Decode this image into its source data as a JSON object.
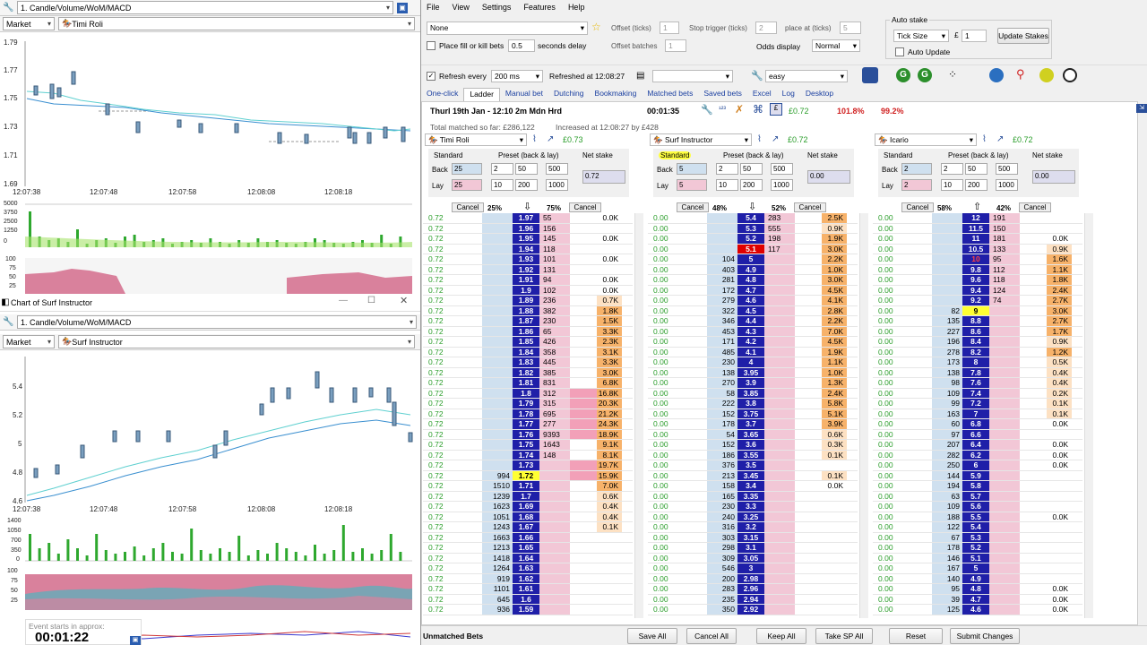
{
  "chart1": {
    "title": "1. Candle/Volume/WoM/MACD",
    "market_label": "Market",
    "runner": "Timi Roli",
    "yticks": [
      "1.79",
      "1.77",
      "1.75",
      "1.73",
      "1.71",
      "1.69"
    ],
    "xticks": [
      "12:07:38",
      "12:07:48",
      "12:07:58",
      "12:08:08",
      "12:08:18"
    ],
    "vol_ticks": [
      "5000",
      "3750",
      "2500",
      "1250",
      "0"
    ],
    "wom_ticks": [
      "100",
      "75",
      "50",
      "25"
    ]
  },
  "chart2": {
    "window_title": "Chart of Surf Instructor",
    "title": "1. Candle/Volume/WoM/MACD",
    "market_label": "Market",
    "runner": "Surf Instructor",
    "yticks": [
      "5.4",
      "5.2",
      "5",
      "4.8",
      "4.6"
    ],
    "xticks": [
      "12:07:38",
      "12:07:48",
      "12:07:58",
      "12:08:08",
      "12:08:18"
    ],
    "vol_ticks": [
      "1400",
      "1050",
      "700",
      "350",
      "0"
    ],
    "wom_ticks": [
      "100",
      "75",
      "50",
      "25"
    ],
    "event_label": "Event starts in approx:",
    "countdown": "00:01:22"
  },
  "menu": [
    "File",
    "View",
    "Settings",
    "Features",
    "Help"
  ],
  "controls": {
    "strategy": "None",
    "offset_label": "Offset (ticks)",
    "offset_val": "1",
    "stop_label": "Stop trigger (ticks)",
    "stop_val": "2",
    "place_label": "place at (ticks)",
    "place_val": "5",
    "fok_label": "Place fill or kill bets",
    "fok_val": "0.5",
    "delay_label": "seconds delay",
    "offset_batches_label": "Offset batches",
    "offset_batches_val": "1",
    "odds_label": "Odds display",
    "odds_val": "Normal",
    "autostake_title": "Auto stake",
    "tick_size": "Tick Size",
    "currency": "£",
    "autostake_val": "1",
    "update_stakes": "Update Stakes",
    "auto_update": "Auto Update",
    "refresh_label": "Refresh every",
    "refresh_val": "200 ms",
    "refreshed": "Refreshed at 12:08:27",
    "mode_val": "easy"
  },
  "tabs": [
    "One-click",
    "Ladder",
    "Manual bet",
    "Dutching",
    "Bookmaking",
    "Matched bets",
    "Saved bets",
    "Excel",
    "Log",
    "Desktop"
  ],
  "market": {
    "name": "Thurl 19th Jan - 12:10 2m Mdn Hrd",
    "time": "00:01:35",
    "pl": "£0.72",
    "pct1": "101.8%",
    "pct2": "99.2%",
    "matched": "Total matched so far: £286,122",
    "increased": "Increased at 12:08:27 by £428"
  },
  "stake_labels": {
    "standard": "Standard",
    "preset": "Preset (back & lay)",
    "net": "Net stake",
    "back": "Back",
    "lay": "Lay",
    "cancel": "Cancel"
  },
  "ladders": [
    {
      "runner": "Timi Roli",
      "pl": "£0.73",
      "back_stake": "25",
      "lay_stake": "25",
      "presets": [
        "2",
        "50",
        "500",
        "10",
        "200",
        "1000"
      ],
      "net": "0.72",
      "pct_back": "25%",
      "pct_lay": "75%",
      "rows": [
        [
          "0.72",
          "",
          "1.97",
          "55",
          "0.0K"
        ],
        [
          "0.72",
          "",
          "1.96",
          "156",
          ""
        ],
        [
          "0.72",
          "",
          "1.95",
          "145",
          "0.0K"
        ],
        [
          "0.72",
          "",
          "1.94",
          "118",
          ""
        ],
        [
          "0.72",
          "",
          "1.93",
          "101",
          "0.0K"
        ],
        [
          "0.72",
          "",
          "1.92",
          "131",
          ""
        ],
        [
          "0.72",
          "",
          "1.91",
          "94",
          "0.0K"
        ],
        [
          "0.72",
          "",
          "1.9",
          "102",
          "0.0K"
        ],
        [
          "0.72",
          "",
          "1.89",
          "236",
          "0.7K"
        ],
        [
          "0.72",
          "",
          "1.88",
          "382",
          "1.8K"
        ],
        [
          "0.72",
          "",
          "1.87",
          "230",
          "1.5K"
        ],
        [
          "0.72",
          "",
          "1.86",
          "65",
          "3.3K"
        ],
        [
          "0.72",
          "",
          "1.85",
          "426",
          "2.3K"
        ],
        [
          "0.72",
          "",
          "1.84",
          "358",
          "3.1K"
        ],
        [
          "0.72",
          "",
          "1.83",
          "445",
          "3.3K"
        ],
        [
          "0.72",
          "",
          "1.82",
          "385",
          "3.0K"
        ],
        [
          "0.72",
          "",
          "1.81",
          "831",
          "6.8K"
        ],
        [
          "0.72",
          "",
          "1.8",
          "312",
          "16.8K"
        ],
        [
          "0.72",
          "",
          "1.79",
          "315",
          "20.3K"
        ],
        [
          "0.72",
          "",
          "1.78",
          "695",
          "21.2K"
        ],
        [
          "0.72",
          "",
          "1.77",
          "277",
          "24.3K"
        ],
        [
          "0.72",
          "",
          "1.76",
          "9393",
          "18.9K"
        ],
        [
          "0.72",
          "",
          "1.75",
          "1643",
          "9.1K"
        ],
        [
          "0.72",
          "",
          "1.74",
          "148",
          "8.1K"
        ],
        [
          "0.72",
          "",
          "1.73",
          "",
          "19.7K"
        ],
        [
          "0.72",
          "994",
          "1.72",
          "",
          "15.9K"
        ],
        [
          "0.72",
          "1510",
          "1.71",
          "",
          "7.0K"
        ],
        [
          "0.72",
          "1239",
          "1.7",
          "",
          "0.6K"
        ],
        [
          "0.72",
          "1623",
          "1.69",
          "",
          "0.4K"
        ],
        [
          "0.72",
          "1051",
          "1.68",
          "",
          "0.4K"
        ],
        [
          "0.72",
          "1243",
          "1.67",
          "",
          "0.1K"
        ],
        [
          "0.72",
          "1663",
          "1.66",
          "",
          ""
        ],
        [
          "0.72",
          "1213",
          "1.65",
          "",
          ""
        ],
        [
          "0.72",
          "1418",
          "1.64",
          "",
          ""
        ],
        [
          "0.72",
          "1264",
          "1.63",
          "",
          ""
        ],
        [
          "0.72",
          "919",
          "1.62",
          "",
          ""
        ],
        [
          "0.72",
          "1101",
          "1.61",
          "",
          ""
        ],
        [
          "0.72",
          "645",
          "1.6",
          "",
          ""
        ],
        [
          "0.72",
          "936",
          "1.59",
          "",
          ""
        ]
      ]
    },
    {
      "runner": "Surf Instructor",
      "pl": "£0.72",
      "back_stake": "5",
      "lay_stake": "5",
      "presets": [
        "2",
        "50",
        "500",
        "10",
        "200",
        "1000"
      ],
      "net": "0.00",
      "pct_back": "48%",
      "pct_lay": "52%",
      "rows": [
        [
          "0.00",
          "",
          "5.4",
          "283",
          "2.5K"
        ],
        [
          "0.00",
          "",
          "5.3",
          "555",
          "0.9K"
        ],
        [
          "0.00",
          "",
          "5.2",
          "198",
          "1.9K"
        ],
        [
          "0.00",
          "",
          "5.1",
          "117",
          "3.0K"
        ],
        [
          "0.00",
          "104",
          "5",
          "",
          "2.2K"
        ],
        [
          "0.00",
          "403",
          "4.9",
          "",
          "1.0K"
        ],
        [
          "0.00",
          "281",
          "4.8",
          "",
          "3.0K"
        ],
        [
          "0.00",
          "172",
          "4.7",
          "",
          "4.5K"
        ],
        [
          "0.00",
          "279",
          "4.6",
          "",
          "4.1K"
        ],
        [
          "0.00",
          "322",
          "4.5",
          "",
          "2.8K"
        ],
        [
          "0.00",
          "346",
          "4.4",
          "",
          "2.2K"
        ],
        [
          "0.00",
          "453",
          "4.3",
          "",
          "7.0K"
        ],
        [
          "0.00",
          "171",
          "4.2",
          "",
          "4.5K"
        ],
        [
          "0.00",
          "485",
          "4.1",
          "",
          "1.9K"
        ],
        [
          "0.00",
          "230",
          "4",
          "",
          "1.1K"
        ],
        [
          "0.00",
          "138",
          "3.95",
          "",
          "1.0K"
        ],
        [
          "0.00",
          "270",
          "3.9",
          "",
          "1.3K"
        ],
        [
          "0.00",
          "58",
          "3.85",
          "",
          "2.4K"
        ],
        [
          "0.00",
          "222",
          "3.8",
          "",
          "5.8K"
        ],
        [
          "0.00",
          "152",
          "3.75",
          "",
          "5.1K"
        ],
        [
          "0.00",
          "178",
          "3.7",
          "",
          "3.9K"
        ],
        [
          "0.00",
          "54",
          "3.65",
          "",
          "0.6K"
        ],
        [
          "0.00",
          "152",
          "3.6",
          "",
          "0.3K"
        ],
        [
          "0.00",
          "186",
          "3.55",
          "",
          "0.1K"
        ],
        [
          "0.00",
          "376",
          "3.5",
          "",
          ""
        ],
        [
          "0.00",
          "213",
          "3.45",
          "",
          "0.1K"
        ],
        [
          "0.00",
          "158",
          "3.4",
          "",
          "0.0K"
        ],
        [
          "0.00",
          "165",
          "3.35",
          "",
          ""
        ],
        [
          "0.00",
          "230",
          "3.3",
          "",
          ""
        ],
        [
          "0.00",
          "240",
          "3.25",
          "",
          ""
        ],
        [
          "0.00",
          "316",
          "3.2",
          "",
          ""
        ],
        [
          "0.00",
          "303",
          "3.15",
          "",
          ""
        ],
        [
          "0.00",
          "298",
          "3.1",
          "",
          ""
        ],
        [
          "0.00",
          "309",
          "3.05",
          "",
          ""
        ],
        [
          "0.00",
          "546",
          "3",
          "",
          ""
        ],
        [
          "0.00",
          "200",
          "2.98",
          "",
          ""
        ],
        [
          "0.00",
          "283",
          "2.96",
          "",
          ""
        ],
        [
          "0.00",
          "235",
          "2.94",
          "",
          ""
        ],
        [
          "0.00",
          "350",
          "2.92",
          "",
          ""
        ]
      ]
    },
    {
      "runner": "Icario",
      "pl": "£0.72",
      "back_stake": "2",
      "lay_stake": "2",
      "presets": [
        "2",
        "50",
        "500",
        "10",
        "200",
        "1000"
      ],
      "net": "0.00",
      "pct_back": "58%",
      "pct_lay": "42%",
      "rows": [
        [
          "0.00",
          "",
          "12",
          "191",
          ""
        ],
        [
          "0.00",
          "",
          "11.5",
          "150",
          ""
        ],
        [
          "0.00",
          "",
          "11",
          "181",
          "0.0K"
        ],
        [
          "0.00",
          "",
          "10.5",
          "133",
          "0.9K"
        ],
        [
          "0.00",
          "",
          "10",
          "95",
          "1.6K"
        ],
        [
          "0.00",
          "",
          "9.8",
          "112",
          "1.1K"
        ],
        [
          "0.00",
          "",
          "9.6",
          "118",
          "1.8K"
        ],
        [
          "0.00",
          "",
          "9.4",
          "124",
          "2.4K"
        ],
        [
          "0.00",
          "",
          "9.2",
          "74",
          "2.7K"
        ],
        [
          "0.00",
          "82",
          "9",
          "",
          "3.0K"
        ],
        [
          "0.00",
          "135",
          "8.8",
          "",
          "2.7K"
        ],
        [
          "0.00",
          "227",
          "8.6",
          "",
          "1.7K"
        ],
        [
          "0.00",
          "196",
          "8.4",
          "",
          "0.9K"
        ],
        [
          "0.00",
          "278",
          "8.2",
          "",
          "1.2K"
        ],
        [
          "0.00",
          "173",
          "8",
          "",
          "0.5K"
        ],
        [
          "0.00",
          "138",
          "7.8",
          "",
          "0.4K"
        ],
        [
          "0.00",
          "98",
          "7.6",
          "",
          "0.4K"
        ],
        [
          "0.00",
          "109",
          "7.4",
          "",
          "0.2K"
        ],
        [
          "0.00",
          "99",
          "7.2",
          "",
          "0.1K"
        ],
        [
          "0.00",
          "163",
          "7",
          "",
          "0.1K"
        ],
        [
          "0.00",
          "60",
          "6.8",
          "",
          "0.0K"
        ],
        [
          "0.00",
          "97",
          "6.6",
          "",
          ""
        ],
        [
          "0.00",
          "207",
          "6.4",
          "",
          "0.0K"
        ],
        [
          "0.00",
          "282",
          "6.2",
          "",
          "0.0K"
        ],
        [
          "0.00",
          "250",
          "6",
          "",
          "0.0K"
        ],
        [
          "0.00",
          "144",
          "5.9",
          "",
          ""
        ],
        [
          "0.00",
          "194",
          "5.8",
          "",
          ""
        ],
        [
          "0.00",
          "63",
          "5.7",
          "",
          ""
        ],
        [
          "0.00",
          "109",
          "5.6",
          "",
          ""
        ],
        [
          "0.00",
          "188",
          "5.5",
          "",
          "0.0K"
        ],
        [
          "0.00",
          "122",
          "5.4",
          "",
          ""
        ],
        [
          "0.00",
          "67",
          "5.3",
          "",
          ""
        ],
        [
          "0.00",
          "178",
          "5.2",
          "",
          ""
        ],
        [
          "0.00",
          "146",
          "5.1",
          "",
          ""
        ],
        [
          "0.00",
          "167",
          "5",
          "",
          ""
        ],
        [
          "0.00",
          "140",
          "4.9",
          "",
          ""
        ],
        [
          "0.00",
          "95",
          "4.8",
          "",
          "0.0K"
        ],
        [
          "0.00",
          "39",
          "4.7",
          "",
          "0.0K"
        ],
        [
          "0.00",
          "125",
          "4.6",
          "",
          "0.0K"
        ]
      ]
    }
  ],
  "bottom": {
    "label": "Unmatched Bets",
    "buttons": [
      "Save All",
      "Cancel All",
      "Keep All",
      "Take SP All",
      "Reset",
      "Submit Changes"
    ]
  }
}
